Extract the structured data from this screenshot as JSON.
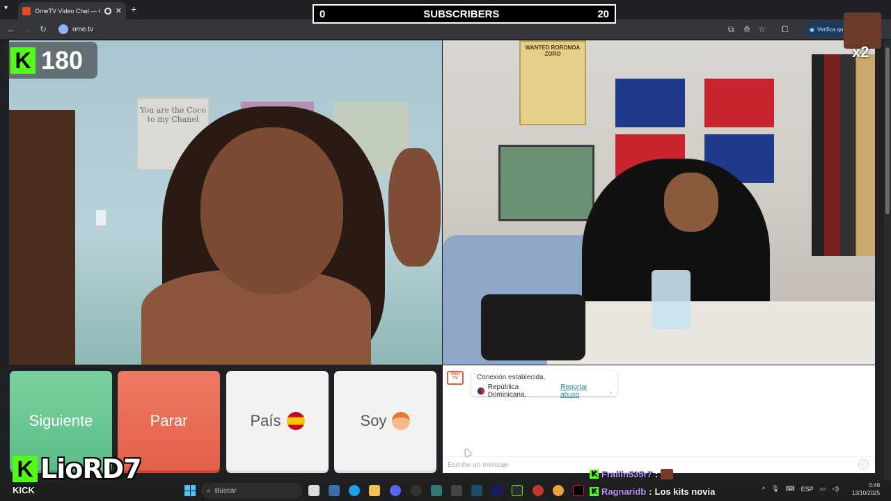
{
  "browser": {
    "tab_title": "OmeTV Video Chat — Ome",
    "url": "ome.tv",
    "verify_label": "Verifica qu"
  },
  "overlay": {
    "subscribers_left": "0",
    "subscribers_label": "SUBSCRIBERS",
    "subscribers_right": "20",
    "kick_count": "180",
    "multiplier": "x2",
    "kick_logo_letter": "K",
    "streamer_name": "LioRD7",
    "kick_word": "KICK"
  },
  "controls": {
    "next_label": "Siguiente",
    "stop_label": "Parar",
    "country_label": "País",
    "iam_label": "Soy"
  },
  "chat": {
    "logo_text": "Ome TV",
    "connection_text": "Conexión establecida.",
    "country_text": "República Dominicana.",
    "report_link": "Reportar abuso",
    "report_suffix": ".",
    "input_placeholder": "Escribe un mensaje"
  },
  "stream_chat": [
    {
      "user": "Frailin535r7",
      "sep": ":",
      "message": ""
    },
    {
      "user": "Ragnaridb",
      "sep": ":",
      "message": "Los kits novia"
    }
  ],
  "left_video": {
    "wall_picture_text": "You are the Coco to my Chanel"
  },
  "right_video": {
    "poster_text": "WANTED RORONOA ZORO"
  },
  "taskbar": {
    "search_placeholder": "Buscar",
    "language": "ESP",
    "time": "0:49",
    "date": "13/10/2025"
  },
  "colors": {
    "next_button": "#5bbd86",
    "stop_button": "#e3604a",
    "kick_green": "#53fc18",
    "browser_dark": "#202124"
  }
}
